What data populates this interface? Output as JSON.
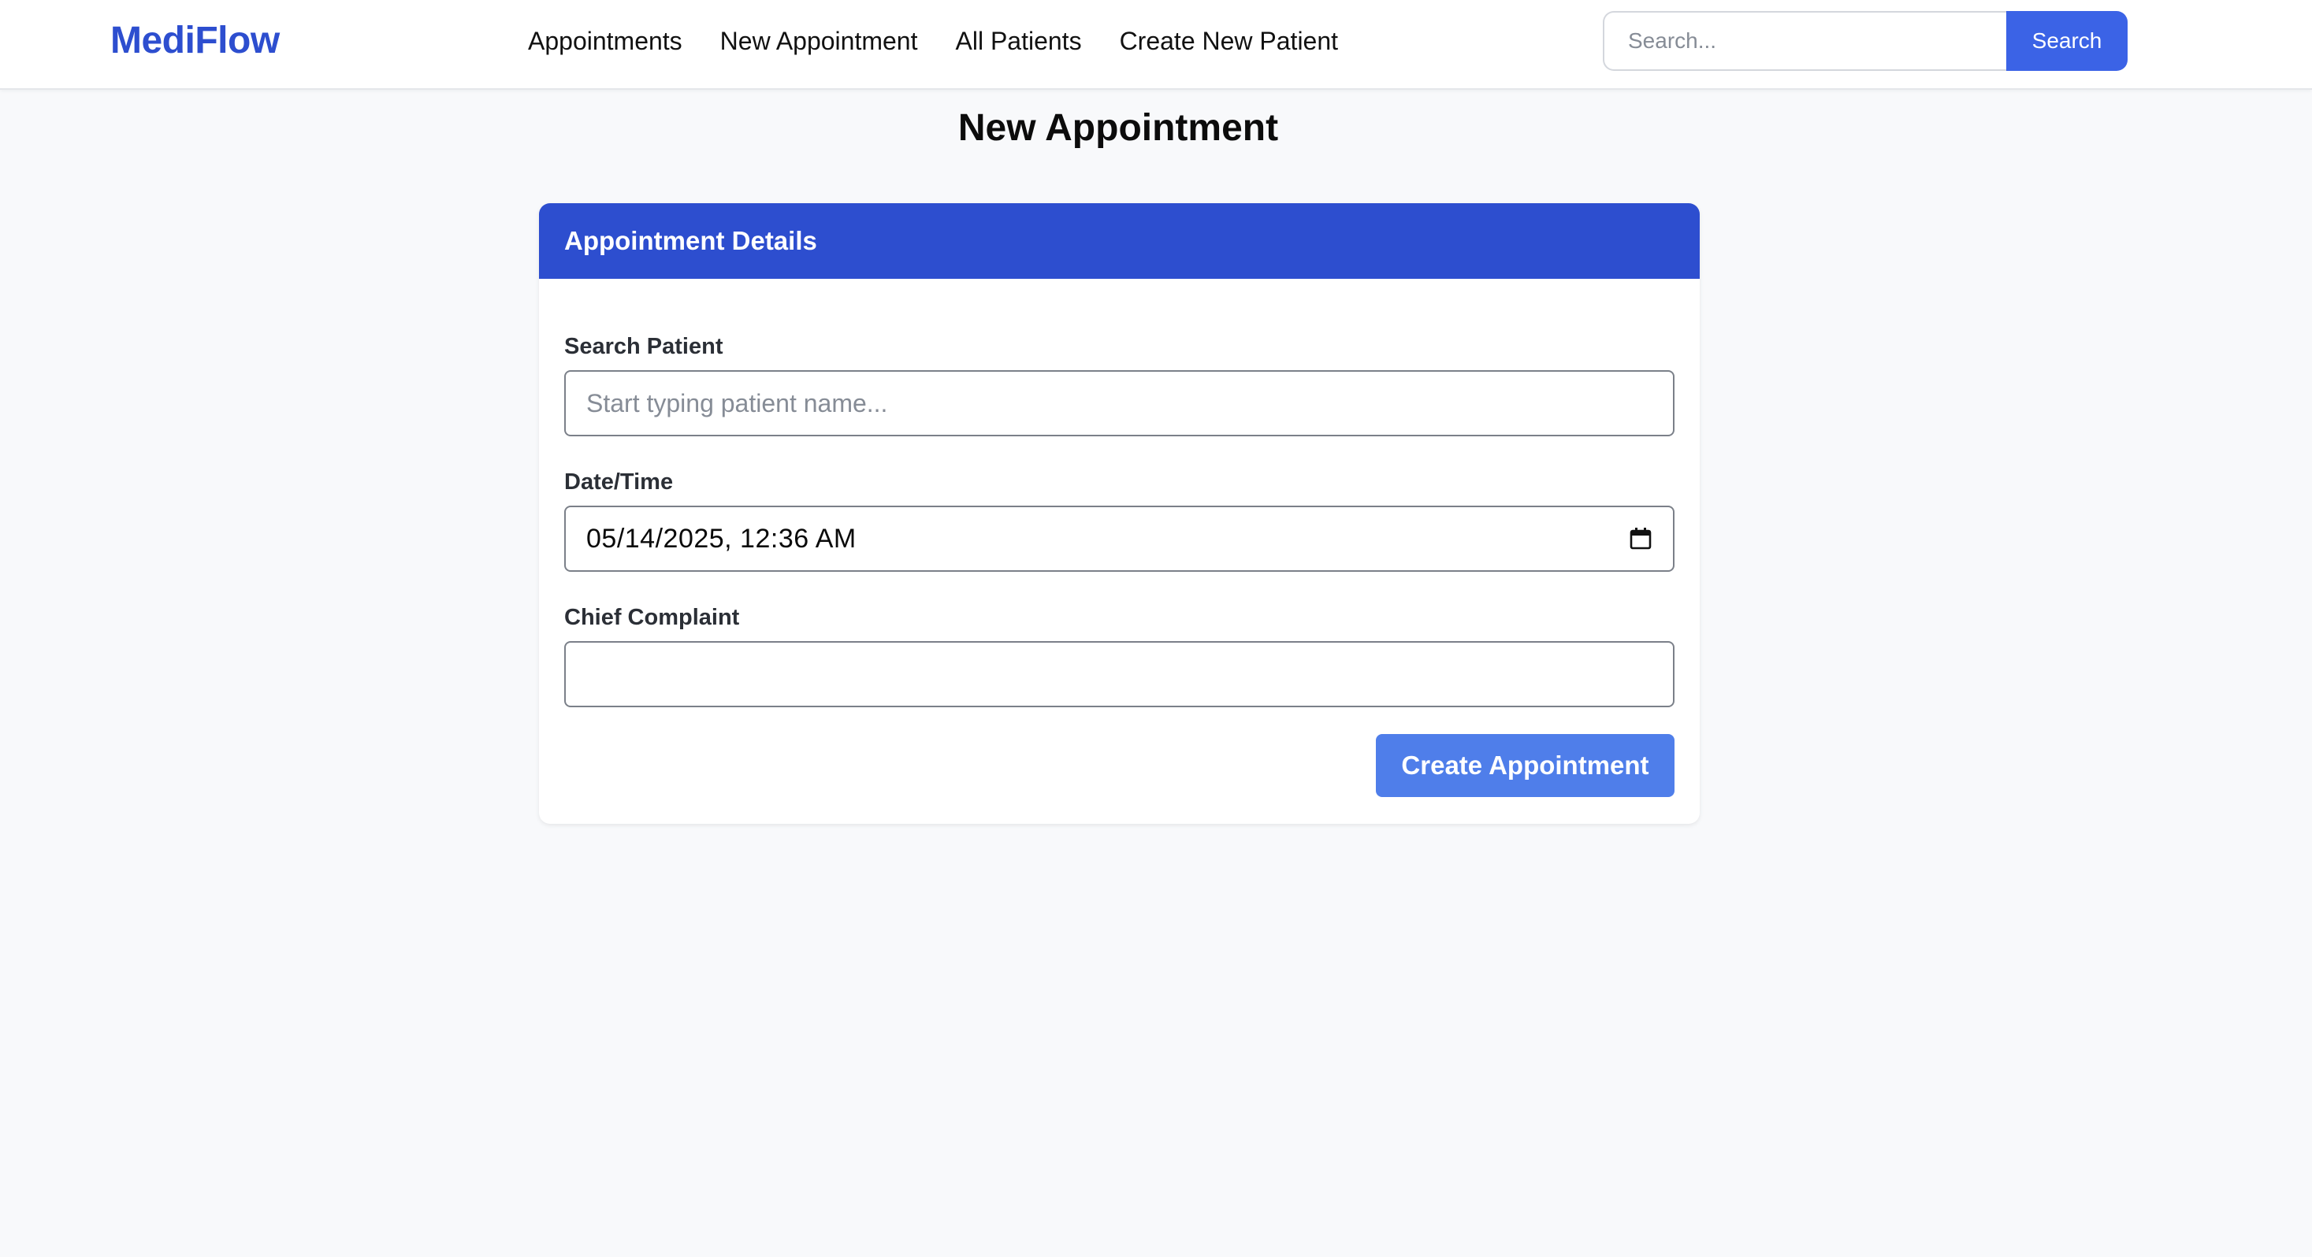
{
  "app": {
    "brand": "MediFlow"
  },
  "nav": {
    "items": [
      {
        "label": "Appointments"
      },
      {
        "label": "New Appointment"
      },
      {
        "label": "All Patients"
      },
      {
        "label": "Create New Patient"
      }
    ],
    "search": {
      "placeholder": "Search...",
      "value": "",
      "button_label": "Search"
    }
  },
  "page": {
    "title": "New Appointment"
  },
  "card": {
    "header_title": "Appointment Details",
    "fields": {
      "patient": {
        "label": "Search Patient",
        "placeholder": "Start typing patient name...",
        "value": ""
      },
      "datetime": {
        "label": "Date/Time",
        "value": "05/14/2025, 12:36 AM",
        "icon": "calendar-icon"
      },
      "complaint": {
        "label": "Chief Complaint",
        "value": ""
      }
    },
    "submit_label": "Create Appointment"
  },
  "colors": {
    "brand": "#2d4ecf",
    "nav_search_button": "#3b63e6",
    "card_header": "#2d4ecf",
    "submit_button": "#4f7eea",
    "page_background": "#f8f9fb"
  }
}
